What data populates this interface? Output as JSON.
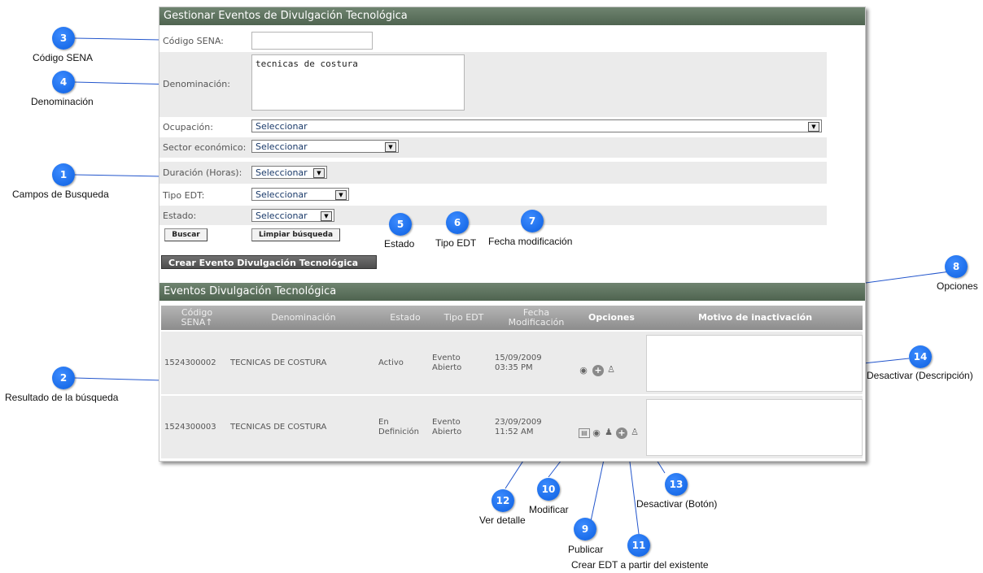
{
  "form": {
    "title": "Gestionar Eventos de Divulgación Tecnológica",
    "codigo_label": "Código SENA:",
    "codigo_value": "",
    "denominacion_label": "Denominación:",
    "denominacion_value": "tecnicas de costura",
    "ocupacion_label": "Ocupación:",
    "ocupacion_value": "Seleccionar",
    "sector_label": "Sector económico:",
    "sector_value": "Seleccionar",
    "duracion_label": "Duración (Horas):",
    "duracion_value": "Seleccionar",
    "tipo_label": "Tipo EDT:",
    "tipo_value": "Seleccionar",
    "estado_label": "Estado:",
    "estado_value": "Seleccionar",
    "buscar_label": "Buscar",
    "limpiar_label": "Limpiar búsqueda",
    "crear_label": "Crear Evento Divulgación Tecnológica"
  },
  "results": {
    "title": "Eventos Divulgación Tecnológica",
    "headers": {
      "codigo": "Código SENA↑",
      "denominacion": "Denominación",
      "estado": "Estado",
      "tipo": "Tipo EDT",
      "fecha": "Fecha Modificación",
      "opciones": "Opciones",
      "motivo": "Motivo de inactivación"
    },
    "rows": [
      {
        "codigo": "1524300002",
        "denominacion": "TECNICAS DE COSTURA",
        "estado": "Activo",
        "tipo": "Evento Abierto",
        "fecha": "15/09/2009 03:35 PM"
      },
      {
        "codigo": "1524300003",
        "denominacion": "TECNICAS DE COSTURA",
        "estado": "En Definición",
        "tipo": "Evento Abierto",
        "fecha": "23/09/2009 11:52 AM"
      }
    ]
  },
  "callouts": {
    "c1": {
      "num": "1",
      "text": "Campos de Busqueda"
    },
    "c2": {
      "num": "2",
      "text": "Resultado de la búsqueda"
    },
    "c3": {
      "num": "3",
      "text": "Código SENA"
    },
    "c4": {
      "num": "4",
      "text": "Denominación"
    },
    "c5": {
      "num": "5",
      "text": "Estado"
    },
    "c6": {
      "num": "6",
      "text": "Tipo EDT"
    },
    "c7": {
      "num": "7",
      "text": "Fecha modificación"
    },
    "c8": {
      "num": "8",
      "text": "Opciones"
    },
    "c9": {
      "num": "9",
      "text": "Publicar"
    },
    "c10": {
      "num": "10",
      "text": "Modificar"
    },
    "c11": {
      "num": "11",
      "text": "Crear EDT a partir del existente"
    },
    "c12": {
      "num": "12",
      "text": "Ver detalle"
    },
    "c13": {
      "num": "13",
      "text": "Desactivar (Botón)"
    },
    "c14": {
      "num": "14",
      "text": "Desactivar (Descripción)"
    }
  },
  "colors": {
    "header_bar": "#5a6e5b",
    "badge": "#1a6ff0"
  }
}
